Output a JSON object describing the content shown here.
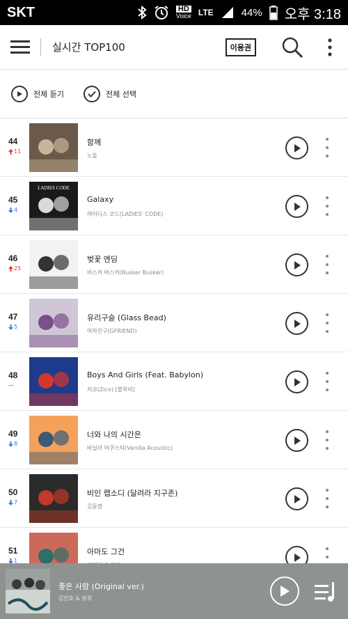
{
  "status_bar": {
    "carrier": "SKT",
    "hd_label": "HD",
    "voice_label": "Voice",
    "lte_label": "LTE",
    "battery": "44%",
    "time": "오후 3:18"
  },
  "appbar": {
    "title": "실시간 TOP100",
    "ticket_label": "이용권"
  },
  "actions": {
    "play_all": "전체 듣기",
    "select_all": "전체 선택"
  },
  "chart_rows": [
    {
      "rank": "44",
      "direction": "up",
      "change": "11",
      "title": "함께",
      "artist": "노을"
    },
    {
      "rank": "45",
      "direction": "down",
      "change": "4",
      "title": "Galaxy",
      "artist": "레이디스 코드(LADIES' CODE)"
    },
    {
      "rank": "46",
      "direction": "up",
      "change": "25",
      "title": "벚꽃 엔딩",
      "artist": "버스커 버스커(Busker Busker)"
    },
    {
      "rank": "47",
      "direction": "down",
      "change": "5",
      "title": "유리구슬 (Glass Bead)",
      "artist": "여자친구(GFRIEND)"
    },
    {
      "rank": "48",
      "direction": "same",
      "change": "—",
      "title": "Boys And Girls (Feat. Babylon)",
      "artist": "지코(Zico) [블락비]"
    },
    {
      "rank": "49",
      "direction": "down",
      "change": "8",
      "title": "너와 나의 시간은",
      "artist": "바닐라 어쿠스틱(Vanilla Acoustic)"
    },
    {
      "rank": "50",
      "direction": "down",
      "change": "7",
      "title": "비인 랩소디 (달려라 지구존)",
      "artist": "김동명"
    },
    {
      "rank": "51",
      "direction": "down",
      "change": "1",
      "title": "아마도 그건",
      "artist": "크러쉬 & 로꼬"
    }
  ],
  "thumbs": [
    {
      "bg": "#6b5a4a",
      "accent": "#c8b49a"
    },
    {
      "bg": "#1a1a1a",
      "accent": "#d9d9d9"
    },
    {
      "bg": "#f2f2f2",
      "accent": "#333333"
    },
    {
      "bg": "#cfc7d8",
      "accent": "#7a4f8a"
    },
    {
      "bg": "#1e3a8a",
      "accent": "#d4382c"
    },
    {
      "bg": "#f4a15a",
      "accent": "#3a5a7a"
    },
    {
      "bg": "#2b2b2b",
      "accent": "#c0392b"
    },
    {
      "bg": "#cc6a5a",
      "accent": "#2e6f6a"
    }
  ],
  "thumb_labels": [
    "",
    "LADIES CODE",
    "",
    "",
    "",
    "",
    "",
    ""
  ],
  "now_playing": {
    "title": "좋은 사람 (Original ver.)",
    "artist": "김진호 & 유희"
  },
  "colors": {
    "up": "#e33333",
    "down": "#3a78d6",
    "player_bg": "#8e938f"
  }
}
